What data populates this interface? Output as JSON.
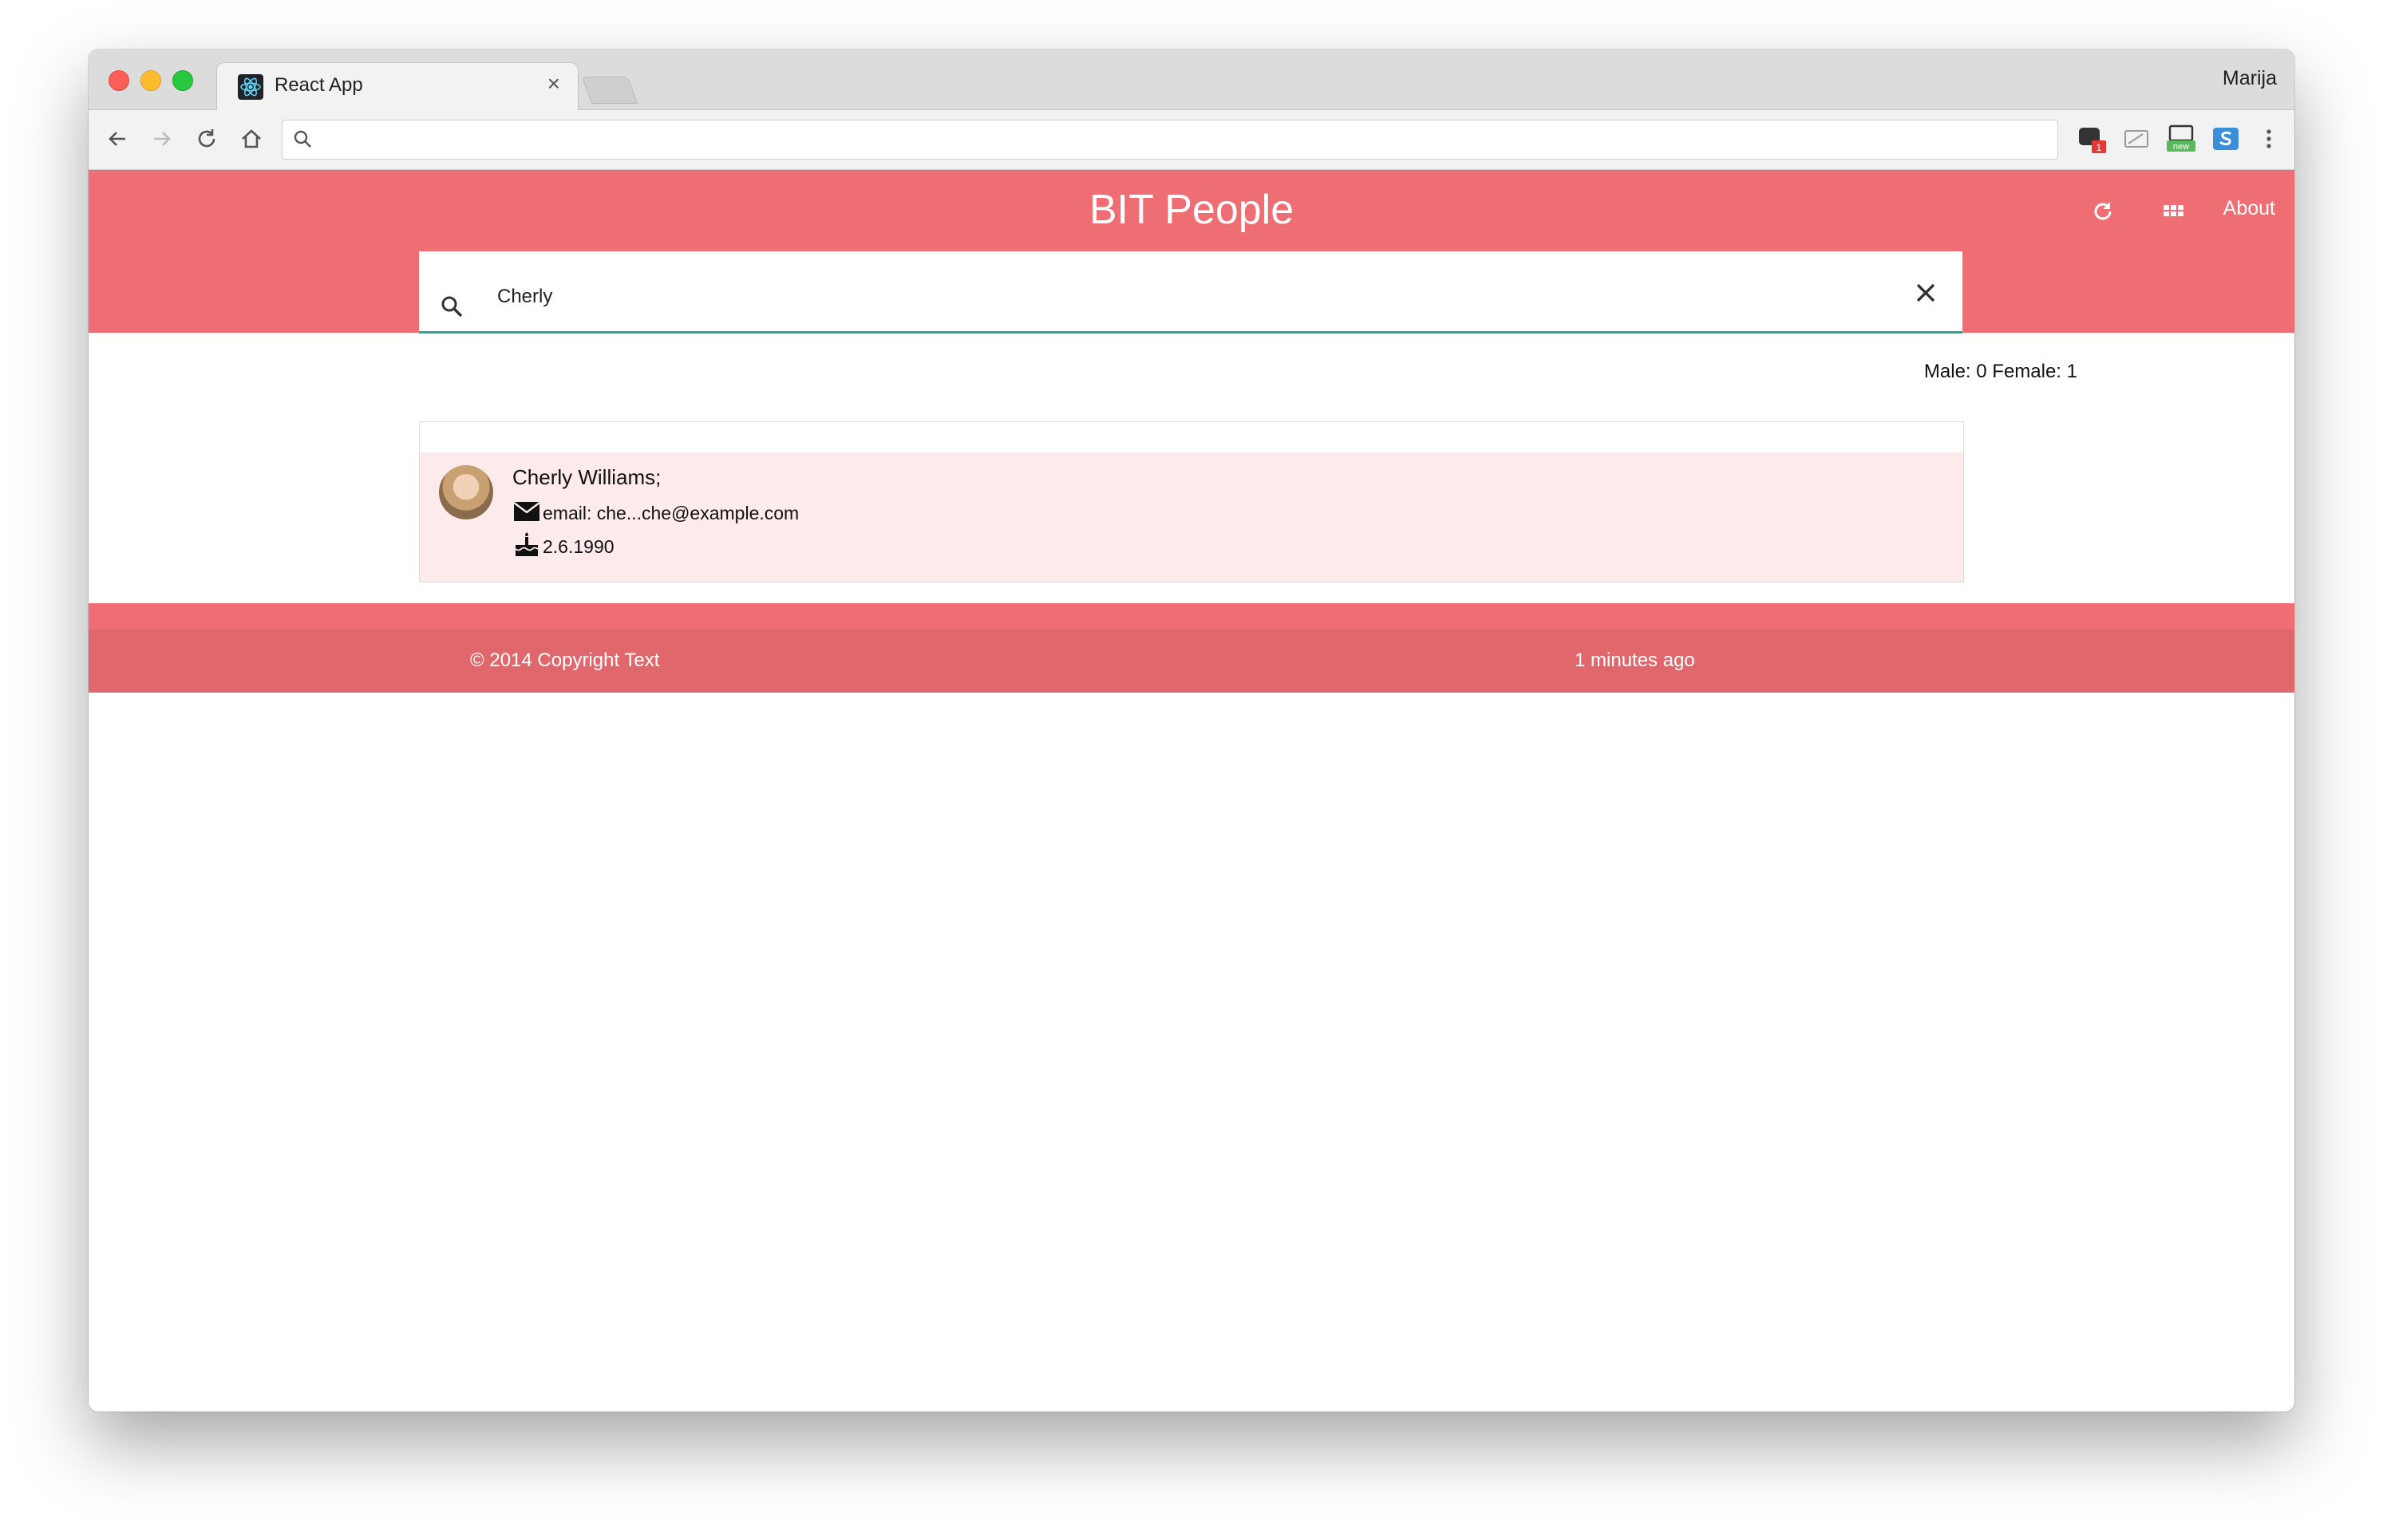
{
  "browser": {
    "tab_title": "React App",
    "tab_close": "×",
    "profile_name": "Marija",
    "address_value": ""
  },
  "app": {
    "title": "BIT People",
    "about_label": "About"
  },
  "search": {
    "value": "Cherly",
    "placeholder": ""
  },
  "stats": {
    "text": "Male: 0 Female: 1"
  },
  "results": [
    {
      "name": "Cherly Williams;",
      "email": "email: che...che@example.com",
      "birthday": "2.6.1990"
    }
  ],
  "footer": {
    "copyright": "© 2014 Copyright Text",
    "updated": "1 minutes ago"
  },
  "colors": {
    "primary": "#ee6e73",
    "footer": "#e0686d",
    "search_underline": "#26a69a",
    "row_highlight": "#fdeaeb"
  }
}
